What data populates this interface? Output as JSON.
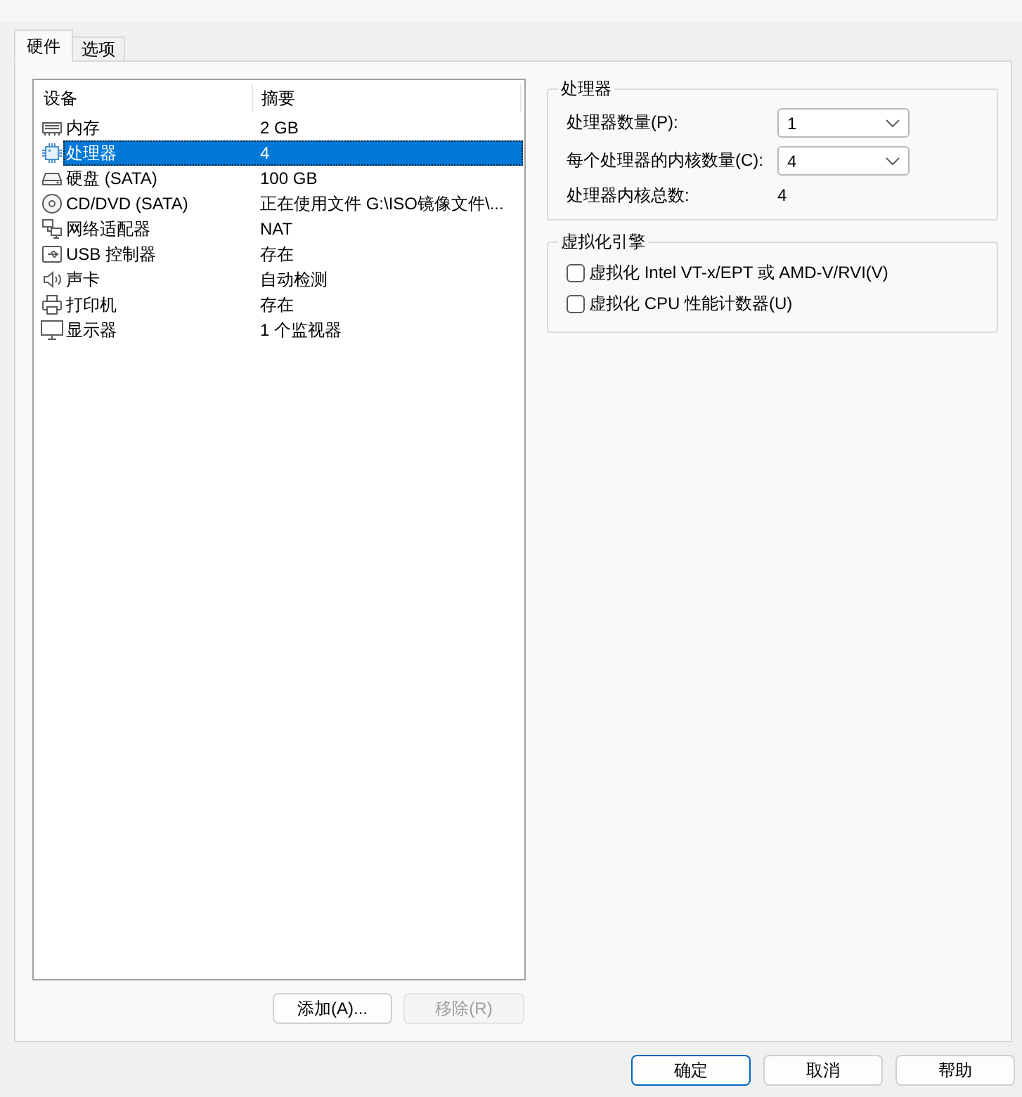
{
  "tabs": [
    {
      "label": "硬件",
      "selected": true
    },
    {
      "label": "选项",
      "selected": false
    }
  ],
  "device_table": {
    "columns": [
      "设备",
      "摘要"
    ],
    "rows": [
      {
        "kind": "memory",
        "device": "内存",
        "summary": "2 GB",
        "selected": false
      },
      {
        "kind": "cpu",
        "device": "处理器",
        "summary": "4",
        "selected": true
      },
      {
        "kind": "disk",
        "device": "硬盘 (SATA)",
        "summary": "100 GB",
        "selected": false
      },
      {
        "kind": "optical",
        "device": "CD/DVD (SATA)",
        "summary": "正在使用文件 G:\\ISO镜像文件\\...",
        "selected": false
      },
      {
        "kind": "network",
        "device": "网络适配器",
        "summary": "NAT",
        "selected": false
      },
      {
        "kind": "usb",
        "device": "USB 控制器",
        "summary": "存在",
        "selected": false
      },
      {
        "kind": "sound",
        "device": "声卡",
        "summary": "自动检测",
        "selected": false
      },
      {
        "kind": "printer",
        "device": "打印机",
        "summary": "存在",
        "selected": false
      },
      {
        "kind": "display",
        "device": "显示器",
        "summary": "1 个监视器",
        "selected": false
      }
    ]
  },
  "device_buttons": [
    {
      "label": "添加(A)...",
      "disabled": false
    },
    {
      "label": "移除(R)",
      "disabled": true
    }
  ],
  "processors": {
    "title": "处理器",
    "fields": [
      {
        "label": "处理器数量(P):",
        "value": "1"
      },
      {
        "label": "每个处理器的内核数量(C):",
        "value": "4"
      }
    ],
    "total": {
      "label": "处理器内核总数:",
      "value": "4"
    }
  },
  "virtualization": {
    "title": "虚拟化引擎",
    "options": [
      {
        "label": "虚拟化 Intel VT-x/EPT 或 AMD-V/RVI(V)",
        "checked": false
      },
      {
        "label": "虚拟化 CPU 性能计数器(U)",
        "checked": false
      }
    ]
  },
  "dialog_buttons": [
    {
      "label": "确定",
      "default": true
    },
    {
      "label": "取消",
      "default": false
    },
    {
      "label": "帮助",
      "default": false
    }
  ]
}
